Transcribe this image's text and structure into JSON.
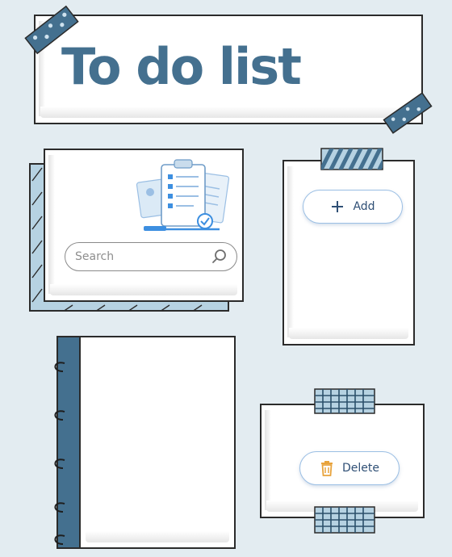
{
  "header": {
    "title": "To do list"
  },
  "search": {
    "placeholder": "Search"
  },
  "actions": {
    "add_label": "Add",
    "delete_label": "Delete"
  },
  "colors": {
    "accent": "#44708f",
    "button_border": "#9bbfe4",
    "delete_icon": "#e8a33c"
  }
}
